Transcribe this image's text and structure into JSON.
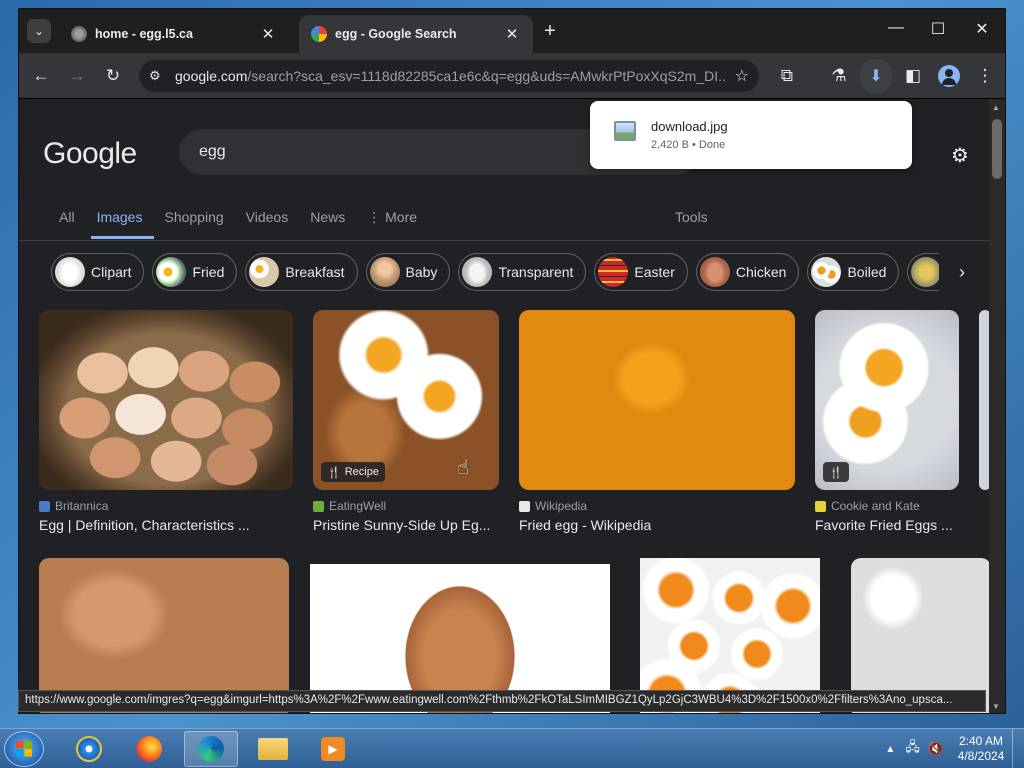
{
  "browser": {
    "tabs": [
      {
        "title": "home - egg.l5.ca",
        "active": false
      },
      {
        "title": "egg - Google Search",
        "active": true
      }
    ],
    "address_host": "google.com",
    "address_rest": "/search?sca_esv=1118d82285ca1e6c&q=egg&uds=AMwkrPtPoxXqS2m_DI...",
    "status_url": "https://www.google.com/imgres?q=egg&imgurl=https%3A%2F%2Fwww.eatingwell.com%2Fthmb%2FkOTaLSImMIBGZ1QyLp2GjC3WBU4%3D%2F1500x0%2Ffilters%3Ano_upsca..."
  },
  "download": {
    "filename": "download.jpg",
    "meta": "2,420 B • Done"
  },
  "google": {
    "logo": "Google",
    "query": "egg",
    "nav": [
      "All",
      "Images",
      "Shopping",
      "Videos",
      "News",
      "More"
    ],
    "more_prefix": "⋮",
    "active_nav": "Images",
    "tools": "Tools",
    "chips": [
      "Clipart",
      "Fried",
      "Breakfast",
      "Baby",
      "Transparent",
      "Easter",
      "Chicken",
      "Boiled"
    ],
    "results": [
      {
        "source": "Britannica",
        "title": "Egg | Definition, Characteristics ..."
      },
      {
        "source": "EatingWell",
        "title": "Pristine Sunny-Side Up Eg...",
        "badge": "Recipe"
      },
      {
        "source": "Wikipedia",
        "title": "Fried egg - Wikipedia"
      },
      {
        "source": "Cookie and Kate",
        "title": "Favorite Fried Eggs ..."
      }
    ]
  },
  "taskbar": {
    "time": "2:40 AM",
    "date": "4/8/2024"
  },
  "colors": {
    "accent": "#8ab4f8",
    "background": "#202124"
  }
}
